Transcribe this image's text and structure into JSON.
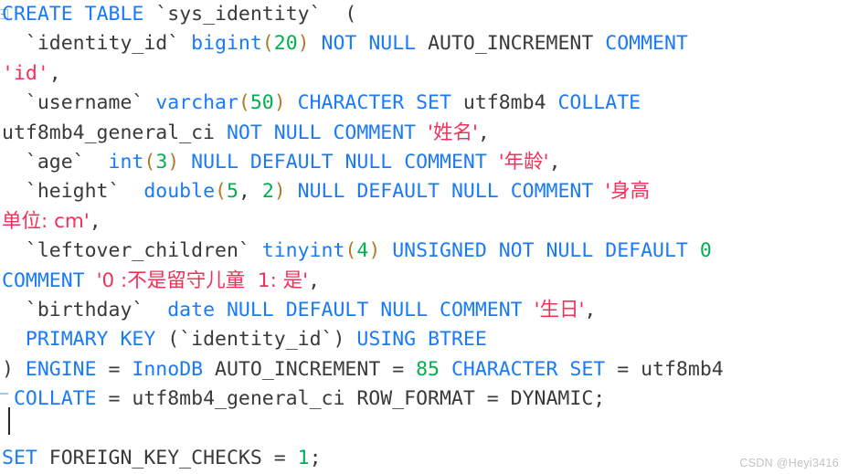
{
  "editor": {
    "background": "#ffffff",
    "font_size_px": 21.5,
    "line_height_px": 32.4,
    "colors": {
      "keyword": "#1a7af8",
      "plain": "#3a3a38",
      "number": "#00b050",
      "string": "#f0325a",
      "paren": "#b07a2a",
      "gutter": "#9fc8ea",
      "caret": "#2b2b2b",
      "watermark": "#c2c2c2"
    },
    "caret": {
      "visible": true,
      "line_index": 13,
      "column": 0
    }
  },
  "gutter": {
    "fold_box": {
      "type": "fold-collapse-box",
      "line_index": 0
    },
    "fold_end_dash": {
      "type": "fold-end-dash",
      "line_index": 12
    }
  },
  "watermark": {
    "text": "CSDN @Heyi3416"
  },
  "sql": {
    "statement_1": "CREATE TABLE `sys_identity` (",
    "statement_2": "SET FOREIGN_KEY_CHECKS = 1;",
    "table_name": "sys_identity",
    "engine": "InnoDB",
    "auto_increment": "85",
    "charset": "utf8mb4",
    "collation": "utf8mb4_general_ci",
    "row_format": "DYNAMIC",
    "primary_key": "identity_id",
    "index_type": "BTREE",
    "columns": [
      {
        "name": "identity_id",
        "type": "bigint(20)",
        "nullability": "NOT NULL",
        "extra": "AUTO_INCREMENT",
        "comment": "id"
      },
      {
        "name": "username",
        "type": "varchar(50)",
        "charset": "utf8mb4",
        "collation": "utf8mb4_general_ci",
        "nullability": "NOT NULL",
        "comment": "姓名"
      },
      {
        "name": "age",
        "type": "int(3)",
        "nullability": "NULL",
        "default": "NULL",
        "comment": "年龄"
      },
      {
        "name": "height",
        "type": "double(5, 2)",
        "nullability": "NULL",
        "default": "NULL",
        "comment": "身高单位: cm"
      },
      {
        "name": "leftover_children",
        "type": "tinyint(4)",
        "sign": "UNSIGNED",
        "nullability": "NOT NULL",
        "default": "0",
        "comment": "0 :不是留守儿童  1: 是"
      },
      {
        "name": "birthday",
        "type": "date",
        "nullability": "NULL",
        "default": "NULL",
        "comment": "生日"
      }
    ]
  },
  "lines": [
    {
      "index": 0,
      "text": "CREATE TABLE `sys_identity`  ("
    },
    {
      "index": 1,
      "text": "  `identity_id` bigint(20) NOT NULL AUTO_INCREMENT COMMENT"
    },
    {
      "index": 2,
      "text": "'id',"
    },
    {
      "index": 3,
      "text": "  `username` varchar(50) CHARACTER SET utf8mb4 COLLATE"
    },
    {
      "index": 4,
      "text": "utf8mb4_general_ci NOT NULL COMMENT '姓名',"
    },
    {
      "index": 5,
      "text": "  `age`  int(3) NULL DEFAULT NULL COMMENT '年龄',"
    },
    {
      "index": 6,
      "text": "  `height`  double(5, 2) NULL DEFAULT NULL COMMENT '身高"
    },
    {
      "index": 7,
      "text": "单位: cm',"
    },
    {
      "index": 8,
      "text": "  `leftover_children` tinyint(4) UNSIGNED NOT NULL DEFAULT 0"
    },
    {
      "index": 9,
      "text": "COMMENT '0 :不是留守儿童  1: 是',"
    },
    {
      "index": 10,
      "text": "  `birthday`  date NULL DEFAULT NULL COMMENT '生日',"
    },
    {
      "index": 11,
      "text": "  PRIMARY KEY (`identity_id`) USING BTREE"
    },
    {
      "index": 12,
      "text": ") ENGINE = InnoDB AUTO_INCREMENT = 85 CHARACTER SET = utf8mb4"
    },
    {
      "index": 13,
      "text": " COLLATE = utf8mb4_general_ci ROW_FORMAT = DYNAMIC;"
    },
    {
      "index": 14,
      "text": ""
    },
    {
      "index": 15,
      "text": "SET FOREIGN_KEY_CHECKS = 1;"
    }
  ],
  "tokens": {
    "l0": {
      "kw1": "CREATE",
      "kw2": "TABLE",
      "id": "`sys_identity`",
      "paren": "("
    },
    "l1": {
      "id": "`identity_id`",
      "type": "bigint",
      "lp": "(",
      "n": "20",
      "rp": ")",
      "kw1": "NOT",
      "kw2": "NULL",
      "ai": "AUTO_INCREMENT",
      "kw3": "COMMENT"
    },
    "l2": {
      "s": "'id'",
      "c": ","
    },
    "l3": {
      "id": "`username`",
      "type": "varchar",
      "lp": "(",
      "n": "50",
      "rp": ")",
      "kw1": "CHARACTER",
      "kw2": "SET",
      "cs": "utf8mb4",
      "kw3": "COLLATE"
    },
    "l4": {
      "coll": "utf8mb4_general_ci",
      "kw1": "NOT",
      "kw2": "NULL",
      "kw3": "COMMENT",
      "s": "'姓名'",
      "c": ","
    },
    "l5": {
      "id": "`age`",
      "type": "int",
      "lp": "(",
      "n": "3",
      "rp": ")",
      "kw1": "NULL",
      "kw2": "DEFAULT",
      "kw3": "NULL",
      "kw4": "COMMENT",
      "s": "'年龄'",
      "c": ","
    },
    "l6": {
      "id": "`height`",
      "type": "double",
      "lp": "(",
      "n1": "5",
      "comma": ", ",
      "n2": "2",
      "rp": ")",
      "kw1": "NULL",
      "kw2": "DEFAULT",
      "kw3": "NULL",
      "kw4": "COMMENT",
      "s": "'身高"
    },
    "l7": {
      "s": "单位: cm'",
      "c": ","
    },
    "l8": {
      "id": "`leftover_children`",
      "type": "tinyint",
      "lp": "(",
      "n": "4",
      "rp": ")",
      "kw1": "UNSIGNED",
      "kw2": "NOT",
      "kw3": "NULL",
      "kw4": "DEFAULT",
      "n2": "0"
    },
    "l9": {
      "kw1": "COMMENT",
      "s": "'0 :不是留守儿童  1: 是'",
      "c": ","
    },
    "l10": {
      "id": "`birthday`",
      "type": "date",
      "kw1": "NULL",
      "kw2": "DEFAULT",
      "kw3": "NULL",
      "kw4": "COMMENT",
      "s": "'生日'",
      "c": ","
    },
    "l11": {
      "kw1": "PRIMARY",
      "kw2": "KEY",
      "lp": "(",
      "id": "`identity_id`",
      "rp": ")",
      "kw3": "USING",
      "kw4": "BTREE"
    },
    "l12": {
      "rp": ")",
      "kw1": "ENGINE",
      "eq1": " = ",
      "eng": "InnoDB",
      "ai": "AUTO_INCREMENT",
      "eq2": " = ",
      "n": "85",
      "kw2": "CHARACTER",
      "kw3": "SET",
      "eq3": " = ",
      "cs": "utf8mb4"
    },
    "l13": {
      "kw1": "COLLATE",
      "eq1": " = ",
      "coll": "utf8mb4_general_ci",
      "rf": "ROW_FORMAT",
      "eq2": " = ",
      "dyn": "DYNAMIC;"
    },
    "l15": {
      "kw1": "SET",
      "fk": "FOREIGN_KEY_CHECKS",
      "eq": " = ",
      "n": "1",
      "semi": ";"
    }
  }
}
